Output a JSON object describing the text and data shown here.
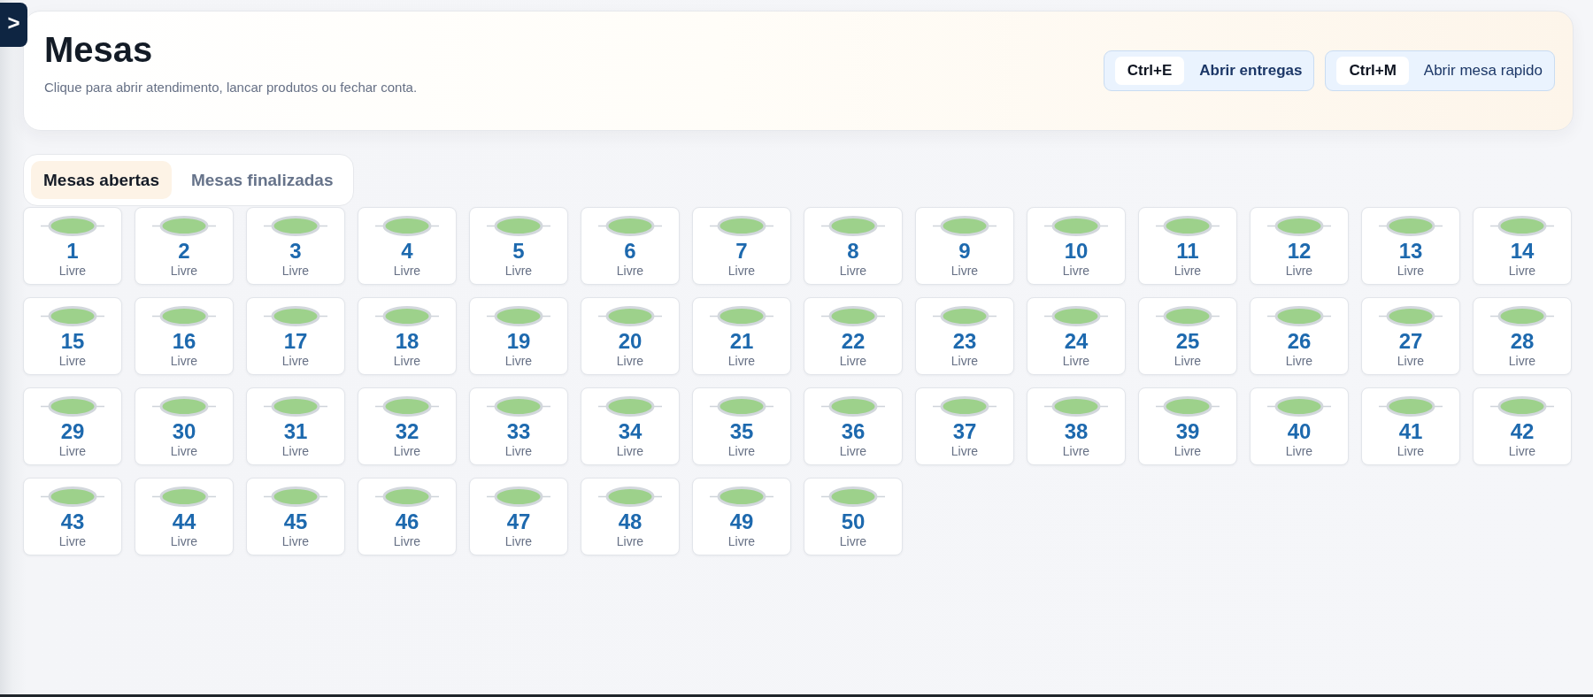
{
  "sidebar_toggle": {
    "label": ">"
  },
  "header": {
    "title": "Mesas",
    "subtitle": "Clique para abrir atendimento, lancar produtos ou fechar conta.",
    "shortcuts": [
      {
        "key": "Ctrl+E",
        "label": "Abrir entregas",
        "primary": true
      },
      {
        "key": "Ctrl+M",
        "label": "Abrir mesa rapido",
        "primary": false
      }
    ]
  },
  "tabs": [
    {
      "label": "Mesas abertas",
      "selected": true
    },
    {
      "label": "Mesas finalizadas",
      "selected": false
    }
  ],
  "tables": [
    {
      "number": "1",
      "status": "Livre"
    },
    {
      "number": "2",
      "status": "Livre"
    },
    {
      "number": "3",
      "status": "Livre"
    },
    {
      "number": "4",
      "status": "Livre"
    },
    {
      "number": "5",
      "status": "Livre"
    },
    {
      "number": "6",
      "status": "Livre"
    },
    {
      "number": "7",
      "status": "Livre"
    },
    {
      "number": "8",
      "status": "Livre"
    },
    {
      "number": "9",
      "status": "Livre"
    },
    {
      "number": "10",
      "status": "Livre"
    },
    {
      "number": "11",
      "status": "Livre"
    },
    {
      "number": "12",
      "status": "Livre"
    },
    {
      "number": "13",
      "status": "Livre"
    },
    {
      "number": "14",
      "status": "Livre"
    },
    {
      "number": "15",
      "status": "Livre"
    },
    {
      "number": "16",
      "status": "Livre"
    },
    {
      "number": "17",
      "status": "Livre"
    },
    {
      "number": "18",
      "status": "Livre"
    },
    {
      "number": "19",
      "status": "Livre"
    },
    {
      "number": "20",
      "status": "Livre"
    },
    {
      "number": "21",
      "status": "Livre"
    },
    {
      "number": "22",
      "status": "Livre"
    },
    {
      "number": "23",
      "status": "Livre"
    },
    {
      "number": "24",
      "status": "Livre"
    },
    {
      "number": "25",
      "status": "Livre"
    },
    {
      "number": "26",
      "status": "Livre"
    },
    {
      "number": "27",
      "status": "Livre"
    },
    {
      "number": "28",
      "status": "Livre"
    },
    {
      "number": "29",
      "status": "Livre"
    },
    {
      "number": "30",
      "status": "Livre"
    },
    {
      "number": "31",
      "status": "Livre"
    },
    {
      "number": "32",
      "status": "Livre"
    },
    {
      "number": "33",
      "status": "Livre"
    },
    {
      "number": "34",
      "status": "Livre"
    },
    {
      "number": "35",
      "status": "Livre"
    },
    {
      "number": "36",
      "status": "Livre"
    },
    {
      "number": "37",
      "status": "Livre"
    },
    {
      "number": "38",
      "status": "Livre"
    },
    {
      "number": "39",
      "status": "Livre"
    },
    {
      "number": "40",
      "status": "Livre"
    },
    {
      "number": "41",
      "status": "Livre"
    },
    {
      "number": "42",
      "status": "Livre"
    },
    {
      "number": "43",
      "status": "Livre"
    },
    {
      "number": "44",
      "status": "Livre"
    },
    {
      "number": "45",
      "status": "Livre"
    },
    {
      "number": "46",
      "status": "Livre"
    },
    {
      "number": "47",
      "status": "Livre"
    },
    {
      "number": "48",
      "status": "Livre"
    },
    {
      "number": "49",
      "status": "Livre"
    },
    {
      "number": "50",
      "status": "Livre"
    }
  ]
}
